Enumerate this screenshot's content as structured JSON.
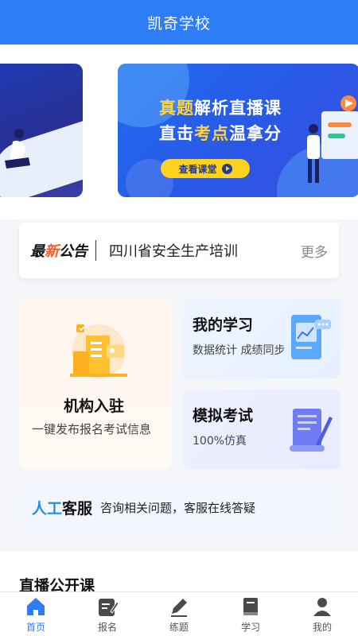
{
  "header": {
    "title": "凯奇学校"
  },
  "banner": {
    "title_parts": [
      "真题",
      "解析直播课"
    ],
    "subtitle_parts": [
      "直击",
      "考点",
      "温拿分"
    ],
    "button_label": "查看课堂"
  },
  "notice": {
    "tag_prefix": "最",
    "tag_highlight": "新",
    "tag_suffix": "公告",
    "text": "四川省安全生产培训",
    "more_label": "更多"
  },
  "cards": {
    "institution": {
      "title": "机构入驻",
      "subtitle": "一键发布报名考试信息"
    },
    "my_study": {
      "title": "我的学习",
      "subtitle": "数据统计 成绩同步"
    },
    "mock_exam": {
      "title": "模拟考试",
      "subtitle": "100%仿真"
    }
  },
  "service": {
    "tag_highlight": "人工",
    "tag_suffix": "客服",
    "text": "咨询相关问题，客服在线答疑"
  },
  "section": {
    "title": "直播公开课"
  },
  "tabbar": {
    "items": [
      {
        "label": "首页",
        "icon": "home-icon",
        "active": true
      },
      {
        "label": "报名",
        "icon": "edit-form-icon",
        "active": false
      },
      {
        "label": "练题",
        "icon": "pencil-icon",
        "active": false
      },
      {
        "label": "学习",
        "icon": "book-icon",
        "active": false
      },
      {
        "label": "我的",
        "icon": "user-icon",
        "active": false
      }
    ]
  },
  "colors": {
    "primary": "#2f7df6",
    "accent_red": "#f35a2a",
    "accent_yellow": "#ffd21f",
    "service_blue": "#1c8fe8"
  }
}
